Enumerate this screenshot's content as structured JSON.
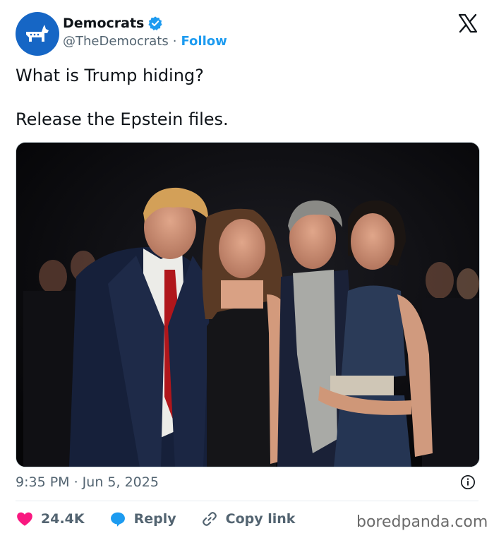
{
  "account": {
    "name": "Democrats",
    "handle": "@TheDemocrats",
    "separator": "·",
    "follow_label": "Follow"
  },
  "post": {
    "line1": "What is Trump hiding?",
    "line2": "Release the Epstein files.",
    "timestamp": "9:35 PM · Jun 5, 2025"
  },
  "actions": {
    "like_count": "24.4K",
    "reply_label": "Reply",
    "copy_label": "Copy link"
  },
  "watermark": "boredpanda.com",
  "colors": {
    "accent": "#1d9bf0",
    "avatar_bg": "#1666c5",
    "like": "#f91880",
    "text_secondary": "#536471"
  },
  "icons": {
    "verified": "verified-badge-icon",
    "x": "x-logo-icon",
    "info": "info-icon",
    "like": "heart-icon",
    "reply": "reply-bubble-icon",
    "copy": "link-icon"
  }
}
